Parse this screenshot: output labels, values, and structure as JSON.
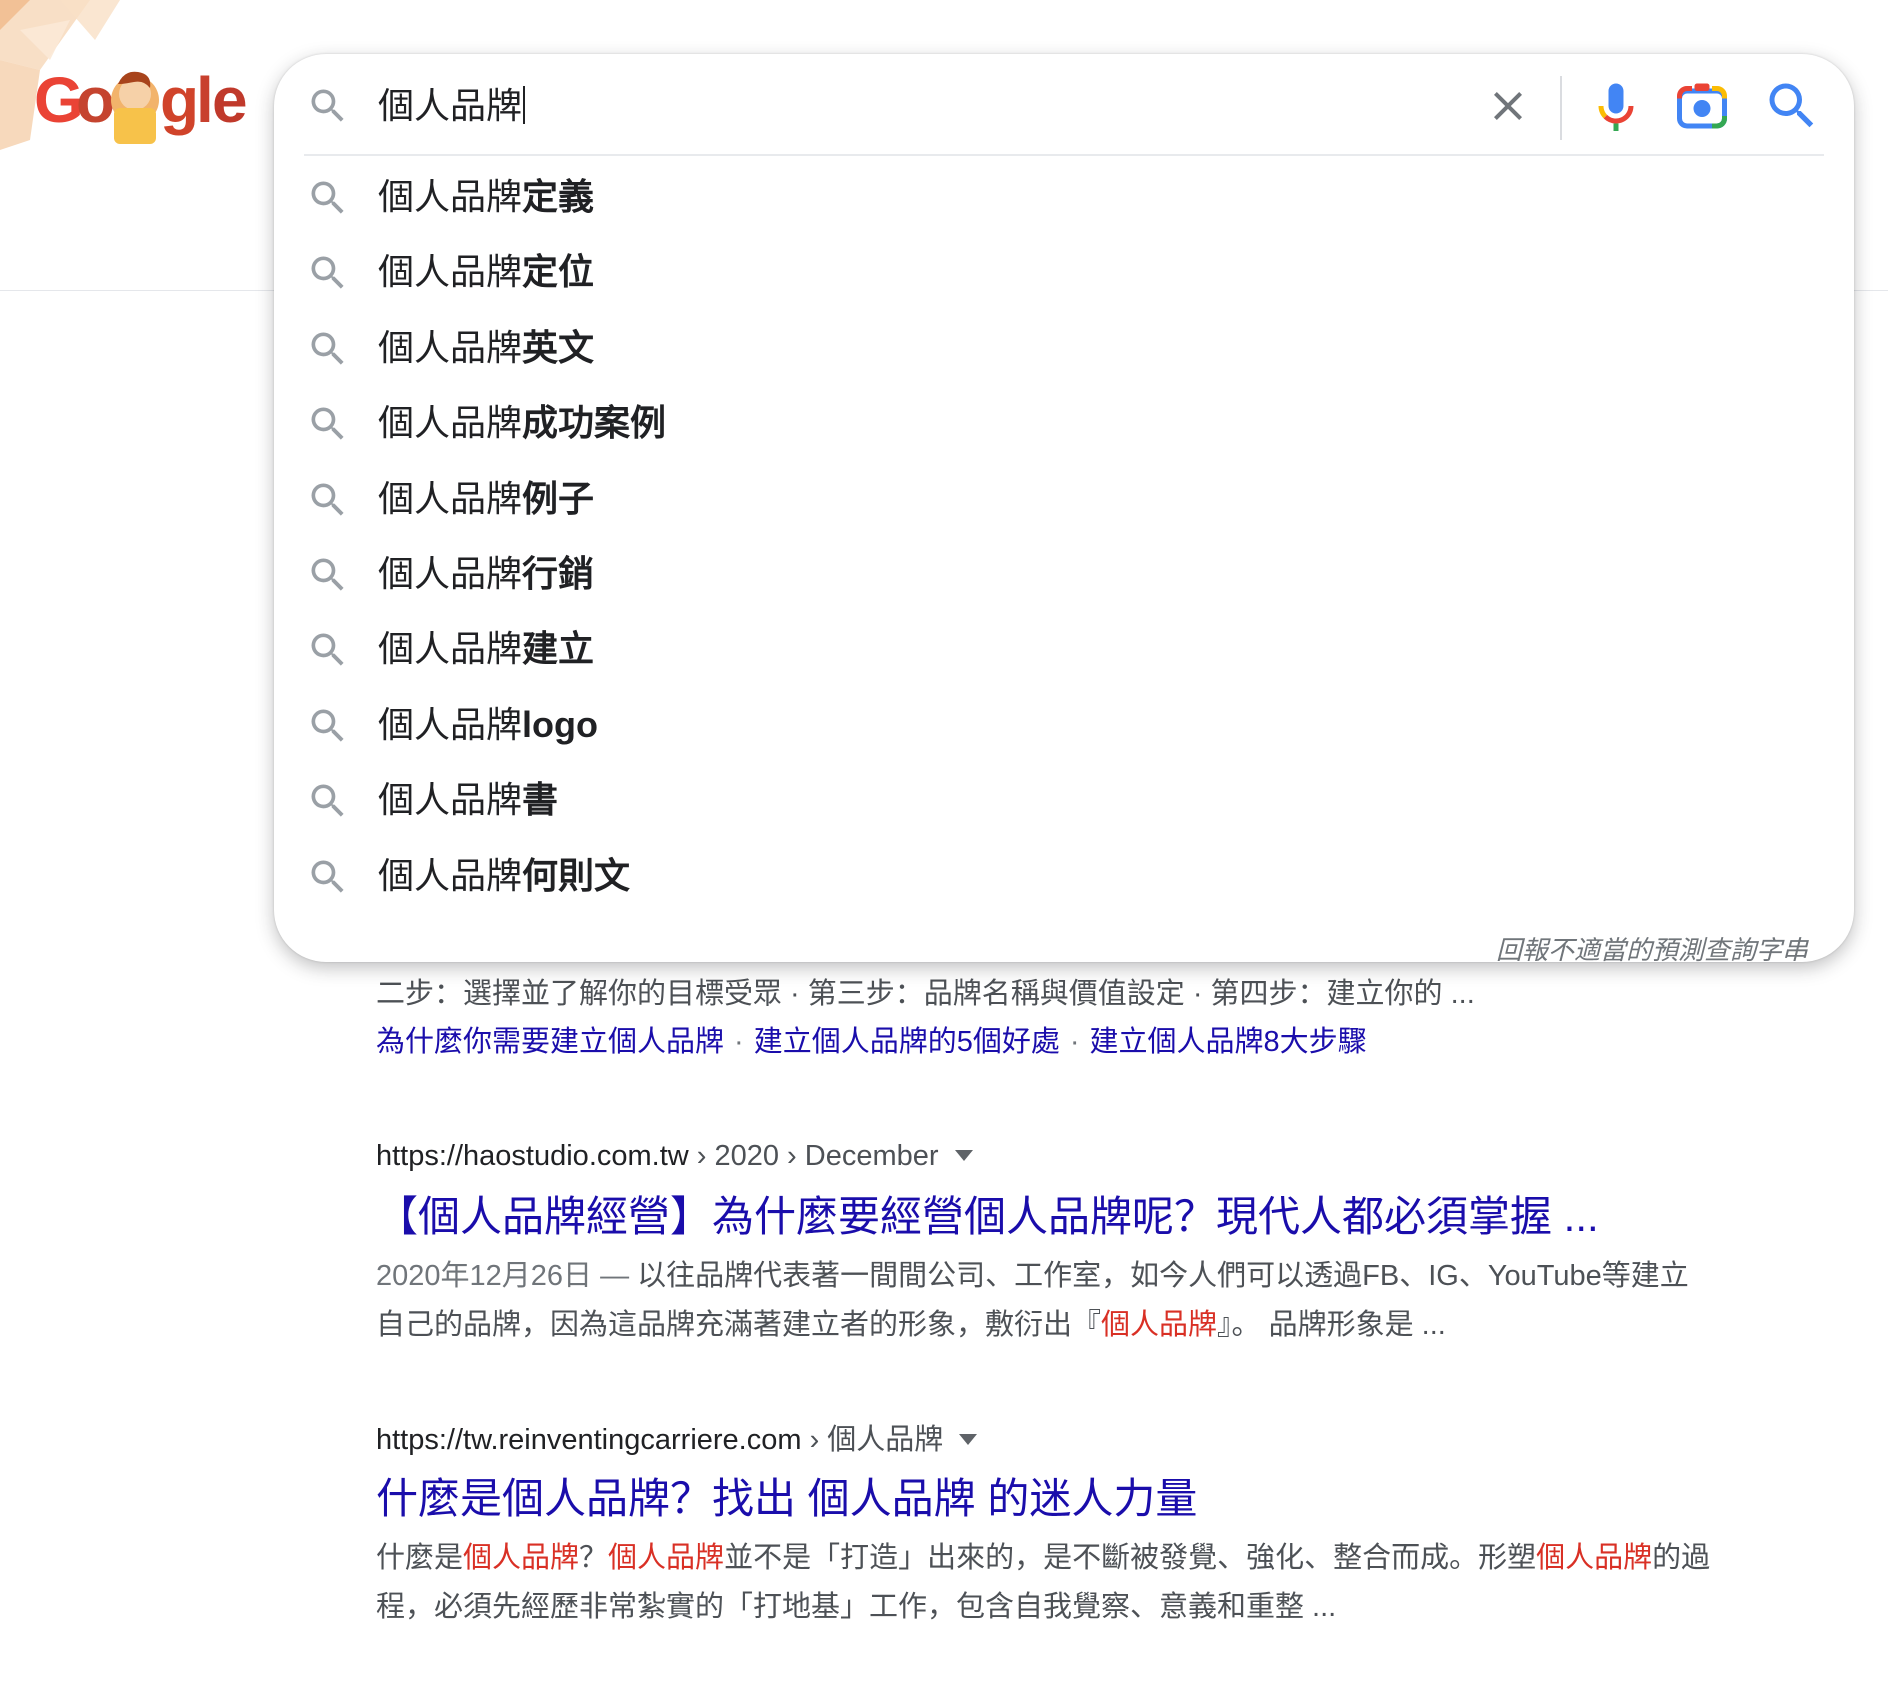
{
  "logo": {
    "text": "Google"
  },
  "search": {
    "query": "個人品牌",
    "clear_label": "清除",
    "voice_label": "語音搜尋",
    "lens_label": "以圖搜尋",
    "submit_label": "搜尋"
  },
  "suggestions": [
    {
      "prefix": "個人品牌",
      "completion": "定義"
    },
    {
      "prefix": "個人品牌",
      "completion": "定位"
    },
    {
      "prefix": "個人品牌",
      "completion": "英文"
    },
    {
      "prefix": "個人品牌",
      "completion": "成功案例"
    },
    {
      "prefix": "個人品牌",
      "completion": "例子"
    },
    {
      "prefix": "個人品牌",
      "completion": "行銷"
    },
    {
      "prefix": "個人品牌",
      "completion": "建立"
    },
    {
      "prefix": "個人品牌",
      "completion": "logo"
    },
    {
      "prefix": "個人品牌",
      "completion": "書"
    },
    {
      "prefix": "個人品牌",
      "completion": "何則文"
    }
  ],
  "report_link": "回報不適當的預測查詢字串",
  "result0": {
    "snippet_tail": "二步：選擇並了解你的目標受眾 · 第三步：品牌名稱與價值設定 · 第四步：建立你的 ...",
    "sitelinks": [
      "為什麼你需要建立個人品牌",
      "建立個人品牌的5個好處",
      "建立個人品牌8大步驟"
    ],
    "sitelink_separator": "·"
  },
  "result1": {
    "url_domain": "https://haostudio.com.tw",
    "url_path": " › 2020 › December",
    "title": "【個人品牌經營】為什麼要經營個人品牌呢？現代人都必須掌握 ...",
    "date": "2020年12月26日 — ",
    "snippet_a": "以往品牌代表著一間間公司、工作室，如今人們可以透過FB、IG、YouTube等建立自己的品牌，因為這品牌充滿著建立者的形象，敷衍出『",
    "snippet_hl": "個人品牌",
    "snippet_b": "』。 品牌形象是 ..."
  },
  "result2": {
    "url_domain": "https://tw.reinventingcarriere.com",
    "url_path": " › 個人品牌",
    "title": "什麼是個人品牌？找出 個人品牌 的迷人力量",
    "snippet_p1": "什麼是",
    "snippet_hl1": "個人品牌",
    "snippet_p2": "？",
    "snippet_hl2": "個人品牌",
    "snippet_p3": "並不是「打造」出來的，是不斷被發覺、強化、整合而成。形塑",
    "snippet_hl3": "個人品牌",
    "snippet_p4": "的過程，必須先經歷非常紮實的「打地基」工作，包含自我覺察、意義和重整 ..."
  },
  "colors": {
    "link": "#1a0dab",
    "highlight": "#d93025",
    "snippet": "#4d5156",
    "google_blue": "#4285f4",
    "google_red": "#ea4335",
    "google_yellow": "#fbbc04",
    "google_green": "#34a853"
  }
}
